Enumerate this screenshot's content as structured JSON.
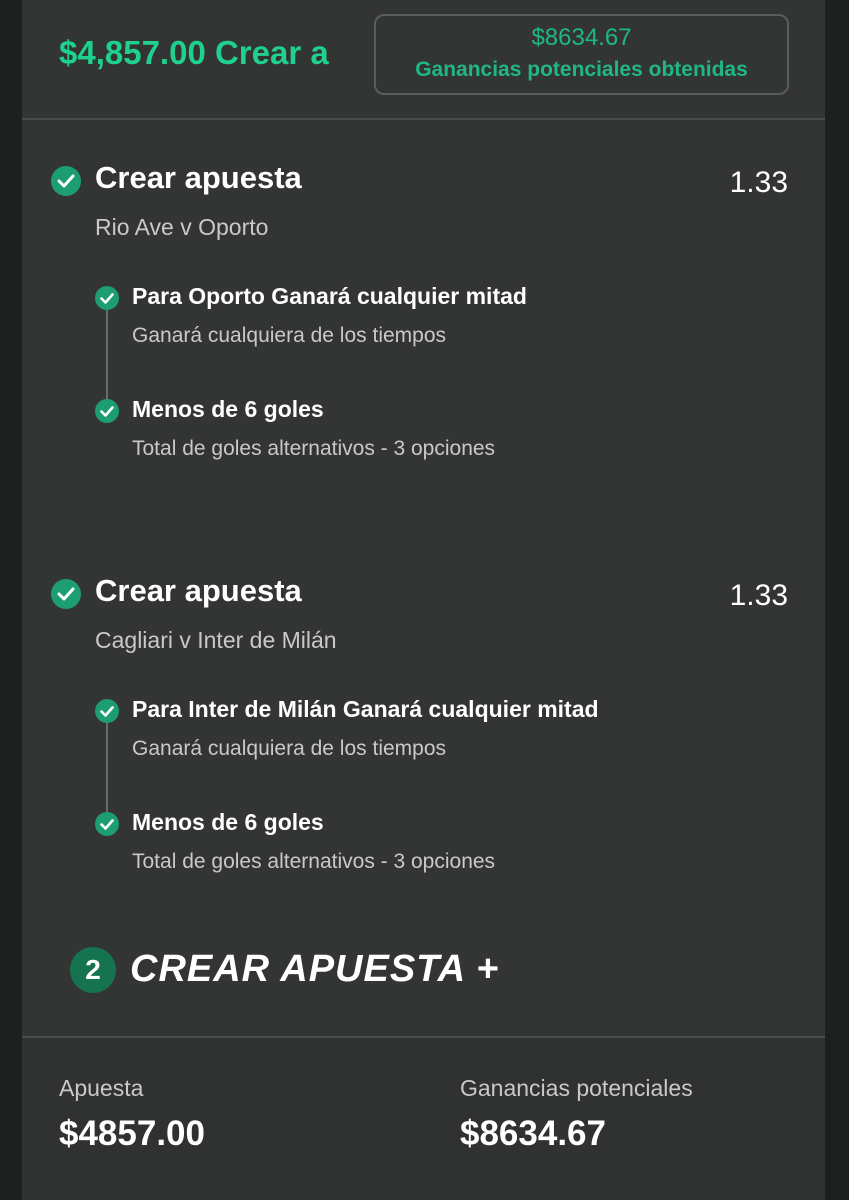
{
  "header": {
    "amount_text": "$4,857.00 Crear a",
    "potential_value": "$8634.67",
    "potential_label": "Ganancias potenciales obtenidas"
  },
  "bets": [
    {
      "title": "Crear apuesta",
      "odds": "1.33",
      "match": "Rio Ave v Oporto",
      "legs": [
        {
          "title": "Para Oporto Ganará cualquier mitad",
          "subtitle": "Ganará cualquiera de los tiempos"
        },
        {
          "title": "Menos de 6 goles",
          "subtitle": "Total de goles alternativos - 3 opciones"
        }
      ]
    },
    {
      "title": "Crear apuesta",
      "odds": "1.33",
      "match": "Cagliari v Inter de Milán",
      "legs": [
        {
          "title": "Para Inter de Milán Ganará cualquier mitad",
          "subtitle": "Ganará cualquiera de los tiempos"
        },
        {
          "title": "Menos de 6 goles",
          "subtitle": "Total de goles alternativos - 3 opciones"
        }
      ]
    }
  ],
  "create_bet": {
    "badge": "2",
    "label": "CREAR APUESTA +"
  },
  "footer": {
    "stake_label": "Apuesta",
    "stake_value": "$4857.00",
    "returns_label": "Ganancias potenciales",
    "returns_value": "$8634.67"
  },
  "colors": {
    "accent": "#1ed18f",
    "check": "#1c9d73",
    "background": "#333534"
  },
  "icons": [
    "check-icon",
    "plus-icon"
  ]
}
